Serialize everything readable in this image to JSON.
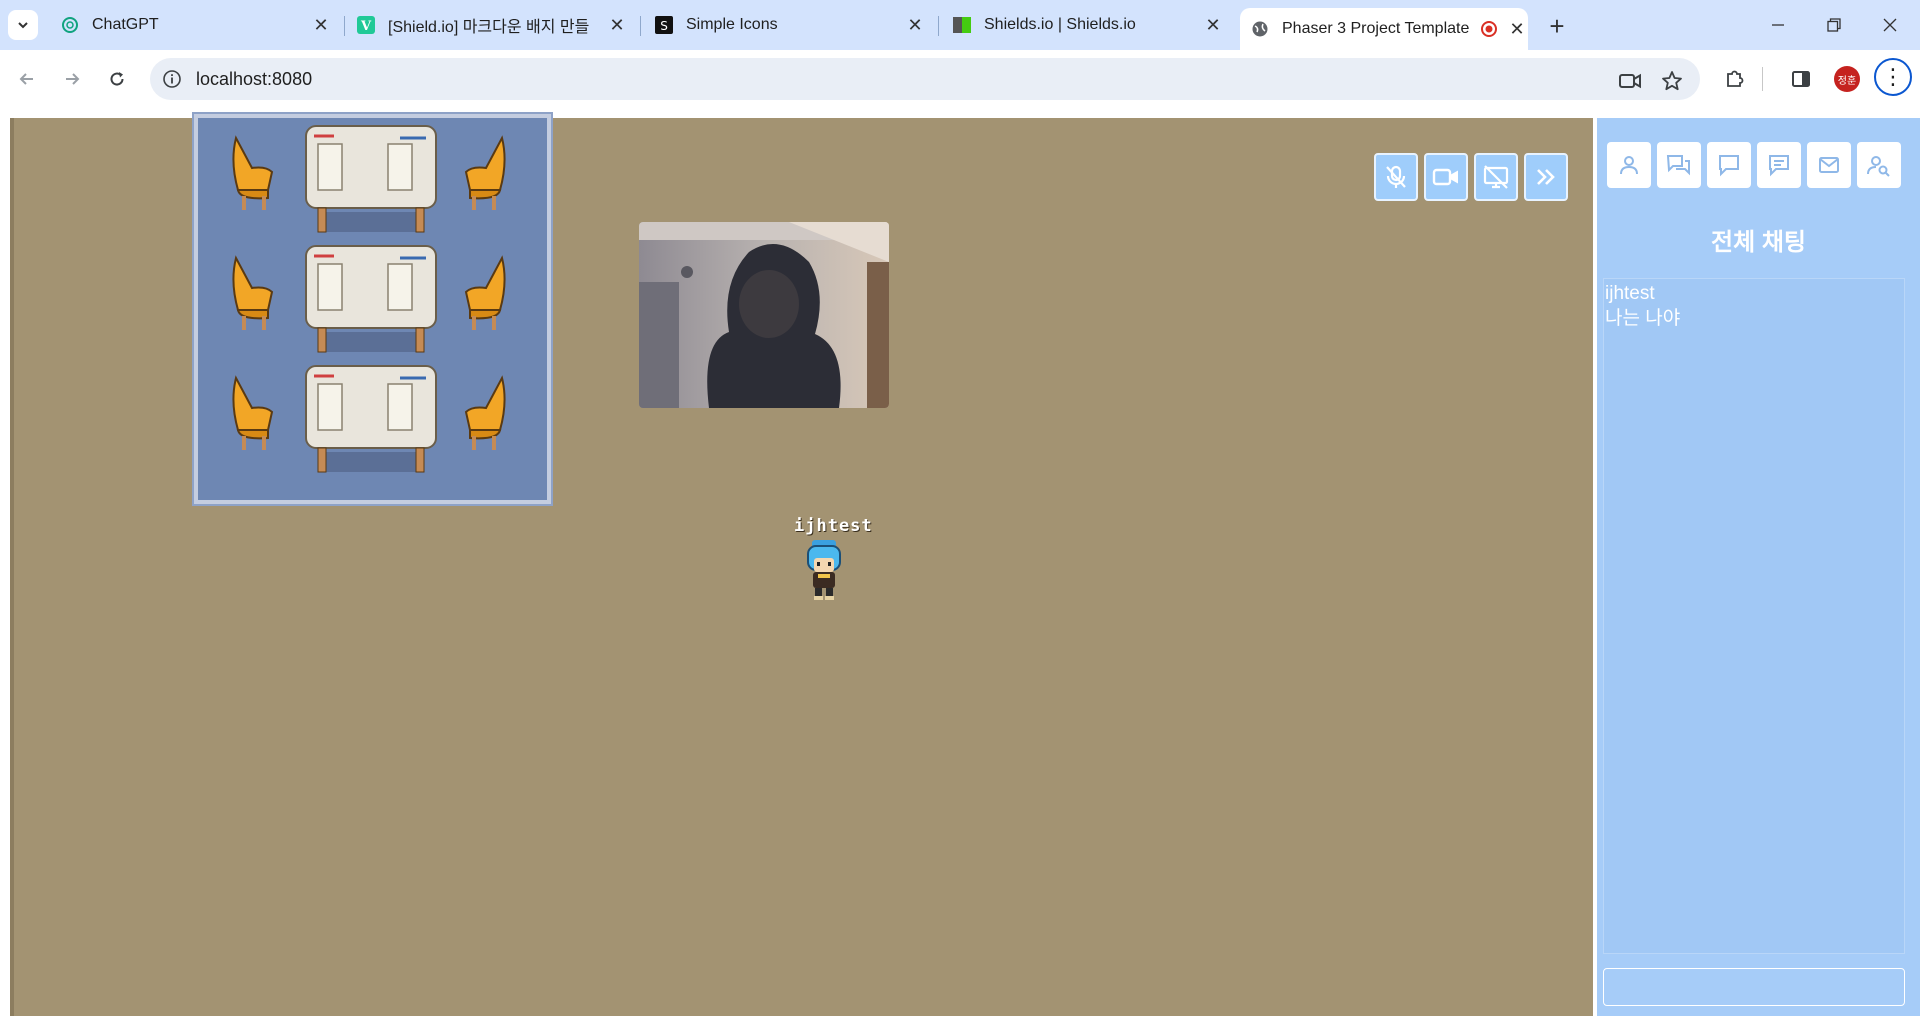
{
  "browser": {
    "tabs": [
      {
        "title": "ChatGPT",
        "icon": "chatgpt-icon"
      },
      {
        "title": "[Shield.io] 마크다운 배지 만들",
        "icon": "velog-icon"
      },
      {
        "title": "Simple Icons",
        "icon": "simple-icons-icon"
      },
      {
        "title": "Shields.io | Shields.io",
        "icon": "shields-icon"
      },
      {
        "title": "Phaser 3 Project Template",
        "icon": "globe-icon",
        "active": true
      }
    ],
    "url": "localhost:8080",
    "profile_initials": "정훈"
  },
  "game": {
    "player_name": "ijhtest",
    "controls": [
      "mic-off-icon",
      "video-camera-icon",
      "screen-share-off-icon",
      "chevron-double-right-icon"
    ]
  },
  "sidebar": {
    "buttons": [
      "user-icon",
      "chats-icon",
      "chat-bubble-icon",
      "message-text-icon",
      "mail-icon",
      "user-search-icon"
    ],
    "chat_title": "전체 채팅",
    "messages": [
      {
        "sender": "ijhtest",
        "text": "나는 나야"
      }
    ],
    "input_placeholder": ""
  },
  "colors": {
    "game_bg": "#a39372",
    "room_bg": "#6e87b3",
    "sidebar_bg": "#a6ccf8",
    "tabstrip_bg": "#d3e3fd"
  }
}
